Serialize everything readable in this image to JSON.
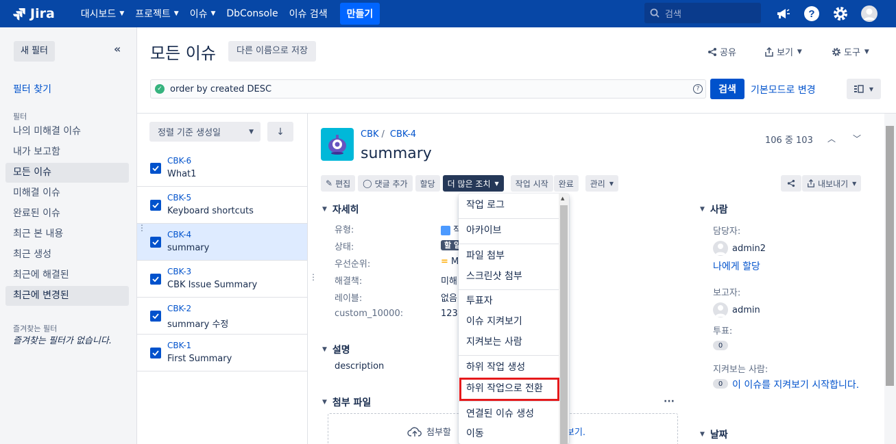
{
  "nav": {
    "logo": "Jira",
    "items": [
      "대시보드",
      "프로젝트",
      "이슈",
      "DbConsole",
      "이슈 검색"
    ],
    "create": "만들기",
    "search_placeholder": "검색"
  },
  "sidebar": {
    "new_filter": "새 필터",
    "find_filters": "필터 찾기",
    "filters_heading": "필터",
    "items": [
      "나의 미해결 이슈",
      "내가 보고함",
      "모든 이슈",
      "미해결 이슈",
      "완료된 이슈",
      "최근 본 내용",
      "최근 생성",
      "최근에 해결된",
      "최근에 변경된"
    ],
    "favorites_heading": "즐겨찾는 필터",
    "no_favorites": "즐겨찾는 필터가 없습니다."
  },
  "header": {
    "title": "모든 이슈",
    "save_as": "다른 이름으로 저장",
    "share": "공유",
    "view": "보기",
    "tools": "도구"
  },
  "query": {
    "jql": "order by created DESC",
    "search": "검색",
    "basic_mode": "기본모드로 변경"
  },
  "list": {
    "sort": "정렬 기준 생성일",
    "issues": [
      {
        "key": "CBK-6",
        "summary": "What1"
      },
      {
        "key": "CBK-5",
        "summary": "Keyboard shortcuts"
      },
      {
        "key": "CBK-4",
        "summary": "summary"
      },
      {
        "key": "CBK-3",
        "summary": "CBK Issue Summary"
      },
      {
        "key": "CBK-2",
        "summary": "summary 수정"
      },
      {
        "key": "CBK-1",
        "summary": "First Summary"
      }
    ]
  },
  "issue": {
    "project": "CBK",
    "key": "CBK-4",
    "title": "summary",
    "counter": "106 중 103",
    "ops": {
      "edit": "편집",
      "comment": "댓글 추가",
      "assign": "할당",
      "more": "더 많은 조치",
      "start": "작업 시작",
      "done": "완료",
      "admin": "관리",
      "export": "내보내기"
    },
    "details_heading": "자세히",
    "fields": [
      {
        "label": "유형:",
        "value": "작"
      },
      {
        "label": "상태:",
        "value": "할 일"
      },
      {
        "label": "우선순위:",
        "value": "M"
      },
      {
        "label": "해결책:",
        "value": "미해"
      },
      {
        "label": "레이블:",
        "value": "없음"
      },
      {
        "label": "custom_10000:",
        "value": "123"
      }
    ],
    "description_heading": "설명",
    "description": "description",
    "attachments_heading": "첨부 파일",
    "drop_text": "첨부할",
    "drop_link": "보기."
  },
  "people": {
    "heading": "사람",
    "assignee_label": "담당자:",
    "assignee": "admin2",
    "assign_me": "나에게 할당",
    "reporter_label": "보고자:",
    "reporter": "admin",
    "votes_label": "투표:",
    "votes": "0",
    "watchers_label": "지켜보는 사람:",
    "watchers": "0",
    "watch_link": "이 이슈를 지켜보기 시작합니다.",
    "dates_heading": "날짜"
  },
  "dropdown": {
    "items": [
      "작업 로그",
      "아카이브",
      "파일 첨부",
      "스크린샷 첨부",
      "투표자",
      "이슈 지켜보기",
      "지켜보는 사람",
      "하위 작업 생성",
      "하위 작업으로 전환",
      "연결된 이슈 생성",
      "이동"
    ]
  },
  "colors": {
    "nav": "#0747a6",
    "primary": "#0052cc",
    "highlight": "#e5191b"
  }
}
